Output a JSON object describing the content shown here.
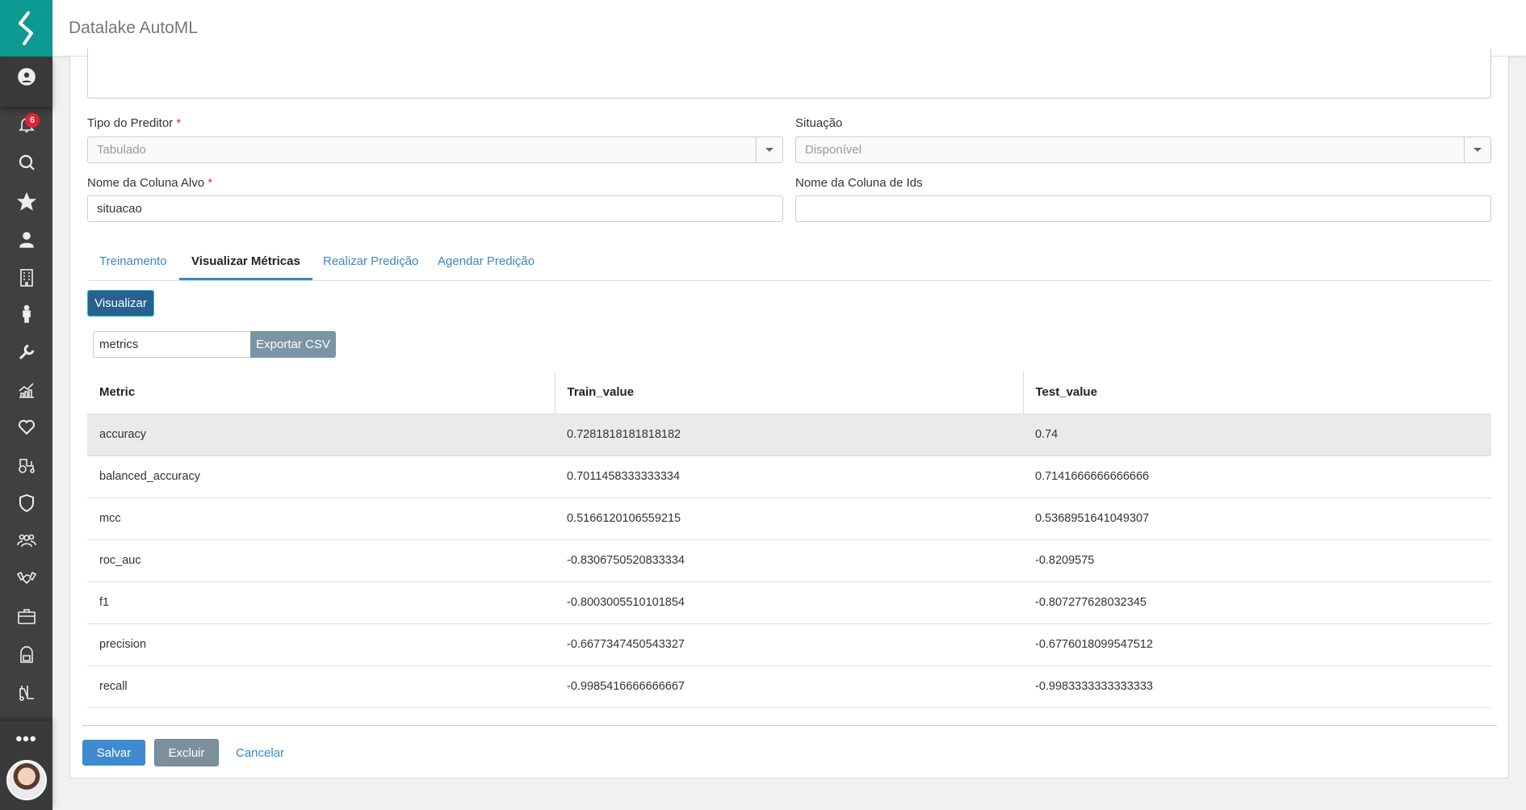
{
  "app": {
    "title": "Datalake AutoML"
  },
  "sidebar": {
    "notification_count": "6",
    "icons": [
      "user-circle-icon",
      "bell-icon",
      "search-icon",
      "star-icon",
      "person-icon",
      "building-icon",
      "man-icon",
      "wrench-icon",
      "chart-icon",
      "heart-icon",
      "tractor-icon",
      "shield-icon",
      "team-icon",
      "handshake-icon",
      "briefcase-icon",
      "backpack-icon",
      "forklift-icon",
      "more-icon"
    ]
  },
  "form": {
    "tipo_label": "Tipo do Preditor",
    "tipo_value": "Tabulado",
    "situacao_label": "Situação",
    "situacao_value": "Disponível",
    "alvo_label": "Nome da Coluna Alvo",
    "alvo_value": "situacao",
    "ids_label": "Nome da Coluna de Ids",
    "ids_value": "",
    "required_mark": "*"
  },
  "tabs": [
    {
      "label": "Treinamento"
    },
    {
      "label": "Visualizar Métricas"
    },
    {
      "label": "Realizar Predição"
    },
    {
      "label": "Agendar Predição"
    }
  ],
  "metrics_panel": {
    "visualizar_label": "Visualizar",
    "filename_value": "metrics",
    "export_label": "Exportar CSV"
  },
  "table": {
    "headers": [
      "Metric",
      "Train_value",
      "Test_value"
    ],
    "rows": [
      [
        "accuracy",
        "0.7281818181818182",
        "0.74"
      ],
      [
        "balanced_accuracy",
        "0.7011458333333334",
        "0.7141666666666666"
      ],
      [
        "mcc",
        "0.5166120106559215",
        "0.5368951641049307"
      ],
      [
        "roc_auc",
        "-0.8306750520833334",
        "-0.8209575"
      ],
      [
        "f1",
        "-0.8003005510101854",
        "-0.807277628032345"
      ],
      [
        "precision",
        "-0.6677347450543327",
        "-0.6776018099547512"
      ],
      [
        "recall",
        "-0.9985416666666667",
        "-0.9983333333333333"
      ]
    ]
  },
  "footer": {
    "save_label": "Salvar",
    "delete_label": "Excluir",
    "cancel_label": "Cancelar"
  }
}
